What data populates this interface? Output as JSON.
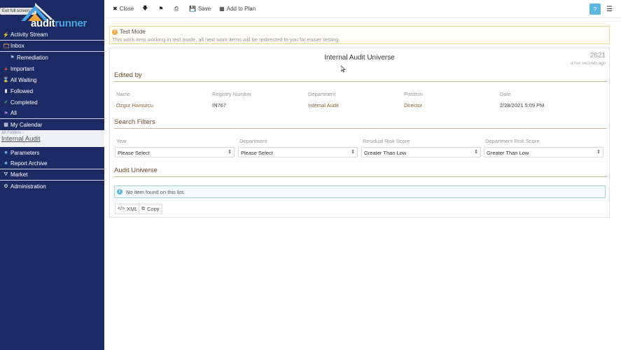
{
  "sidebar": {
    "exit_fullscreen": "Exit full screen (f)",
    "logo": {
      "audit": "audit",
      "runner": "runner"
    },
    "items": [
      {
        "label": "Activity Stream",
        "icon": "bolt-icon"
      },
      {
        "label": "Inbox",
        "icon": "inbox-icon"
      },
      {
        "label": "Remediation",
        "icon": "tag-icon"
      },
      {
        "label": "Important",
        "icon": "warning-icon"
      },
      {
        "label": "All Waiting",
        "icon": "hourglass-icon"
      },
      {
        "label": "Followed",
        "icon": "bookmark-icon"
      },
      {
        "label": "Completed",
        "icon": "check-icon"
      },
      {
        "label": "All",
        "icon": "tags-icon"
      },
      {
        "label": "My Calendar",
        "icon": "calendar-icon"
      },
      {
        "label": "Parameters",
        "icon": "folder-icon"
      },
      {
        "label": "Report Archive",
        "icon": "archive-icon"
      },
      {
        "label": "Market",
        "icon": "cart-icon"
      },
      {
        "label": "Administration",
        "icon": "wrench-icon"
      }
    ],
    "folder": {
      "crumb": "All Folders",
      "sep": "›",
      "title": "Internal Audit"
    }
  },
  "toolbar": {
    "close": "Close",
    "save": "Save",
    "add_to_plan": "Add to Plan"
  },
  "alert": {
    "title": "Test Mode",
    "text": "This work item working in test mode, all next work items will be redirected to you for easier testing."
  },
  "panel": {
    "title": "Internal Audit Universe",
    "number": "2621",
    "time": "a few seconds ago",
    "edited_by": {
      "heading": "Edited by",
      "columns": [
        "Name",
        "Registry Number",
        "Department",
        "Position",
        "Date"
      ],
      "values": [
        "Ozgur Hamurcu",
        "IN767",
        "Internal Audit",
        "Director",
        "2/28/2021 5:09 PM"
      ]
    },
    "filters": {
      "heading": "Search Filters",
      "labels": [
        "Year",
        "Department",
        "Residual Risk Score",
        "Department Risk Score"
      ],
      "selects": [
        "Please Select",
        "Please Select",
        "Greater Than Low",
        "Greater Than Low"
      ]
    },
    "universe": {
      "heading": "Audit Universe",
      "empty": "No item found on this list.",
      "xml": "XML",
      "copy": "Copy"
    }
  },
  "colors": {
    "sidebar_bg": "#1b2a63",
    "accent": "#5cb8e0",
    "section": "#6b4a2b"
  }
}
